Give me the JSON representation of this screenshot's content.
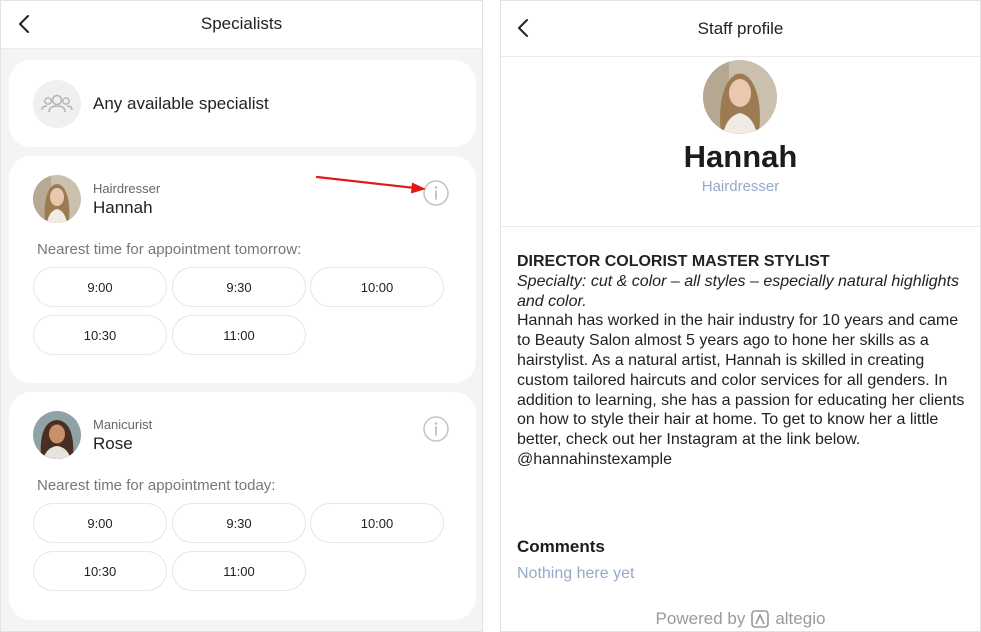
{
  "left": {
    "header_title": "Specialists",
    "any_specialist_label": "Any available specialist",
    "specialists": [
      {
        "role": "Hairdresser",
        "name": "Hannah",
        "nearest_text": "Nearest time for appointment tomorrow:",
        "slots": [
          "9:00",
          "9:30",
          "10:00",
          "10:30",
          "11:00"
        ]
      },
      {
        "role": "Manicurist",
        "name": "Rose",
        "nearest_text": "Nearest time for appointment today:",
        "slots": [
          "9:00",
          "9:30",
          "10:00",
          "10:30",
          "11:00"
        ]
      }
    ]
  },
  "right": {
    "header_title": "Staff profile",
    "name": "Hannah",
    "role": "Hairdresser",
    "bio_heading": "DIRECTOR COLORIST MASTER STYLIST",
    "bio_specialty": "Specialty: cut & color – all styles – especially natural highlights and color.",
    "bio_body": "Hannah has worked in the hair industry for 10 years and came to Beauty Salon almost 5 years ago to hone her skills as a hairstylist. As a natural artist, Hannah is skilled in creating custom tailored haircuts and color services for all genders. In addition to learning, she has a passion for educating her clients on how to style their hair at home. To get to know her a little better, check out her Instagram at the link below.",
    "bio_handle": "@hannahinstexample",
    "comments_title": "Comments",
    "comments_empty": "Nothing here yet",
    "powered_by": "Powered by",
    "brand": "altegio"
  },
  "colors": {
    "background": "#f4f4f4",
    "card": "#ffffff",
    "muted_blue": "#98a8c8",
    "arrow_red": "#e01818",
    "text": "#222222"
  },
  "icons": {
    "back": "chevron-left-icon",
    "info": "info-circle-icon",
    "group": "group-icon",
    "brand": "altegio-logo-icon"
  }
}
